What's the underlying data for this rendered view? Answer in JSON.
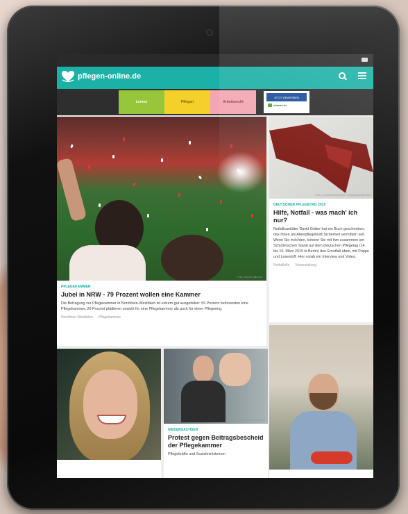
{
  "app": {
    "logo_text": "pflegen-online.de",
    "accent_color": "#1bb1a6"
  },
  "nav": {
    "icons": [
      "search-icon",
      "menu-icon"
    ],
    "categories": [
      {
        "label": "Lernen",
        "color": "#98c63a"
      },
      {
        "label": "Pflegen",
        "color": "#f4d12a"
      },
      {
        "label": "Arbeitsrecht",
        "color": "#f2a7b2"
      }
    ],
    "ad": {
      "button_label": "JETZT BEWERBEN",
      "brand": "vitanas.de"
    }
  },
  "articles": [
    {
      "kicker": "Pflegekammer",
      "title": "Jubel in NRW - 79 Prozent wollen eine Kammer",
      "text": "Die Befragung zur Pflegekammer in Nordrhein-Westfalen ist extrem gut ausgefallen: 59 Prozent befürworten eine Pflegekammer, 20 Prozent plädieren sowohl für eine Pflegekammer als auch für einen Pflegering.",
      "credit": "Foto: picture alliance",
      "tags": [
        "Nordrhein-Westfalen",
        "Pflegekammer"
      ]
    },
    {
      "kicker": "Deutscher Pflegetag 2019",
      "title": "Hilfe, Notfall - was mach' ich nur?",
      "text": "Notfallsanitäter David Gräter hat ein Buch geschrieben, das Ihnen als Altenpflegekraft Sicherheit vermitteln soll. Wenn Sie möchten, können Sie mit ihm zusammen am Schlüterschen Stand auf dem Deutschen Pflegetag (14. bis 16. März 2019 in Berlin) den Ernstfall üben, mit Puppe und Lesestoff. Hier vorab ein Interview und Video.",
      "credit": "Foto: privat/Schlütersche Verlagsgesellschaft",
      "tags": [
        "Notfallhilfe",
        "Veranstaltung"
      ]
    },
    {
      "kicker": "Niedersachsen",
      "title": "Protest gegen Beitragsbescheid der Pflegekammer",
      "text": "Pflegekräfte und Sozialministerium",
      "credit": "Foto: iStock / wildpixel"
    }
  ]
}
